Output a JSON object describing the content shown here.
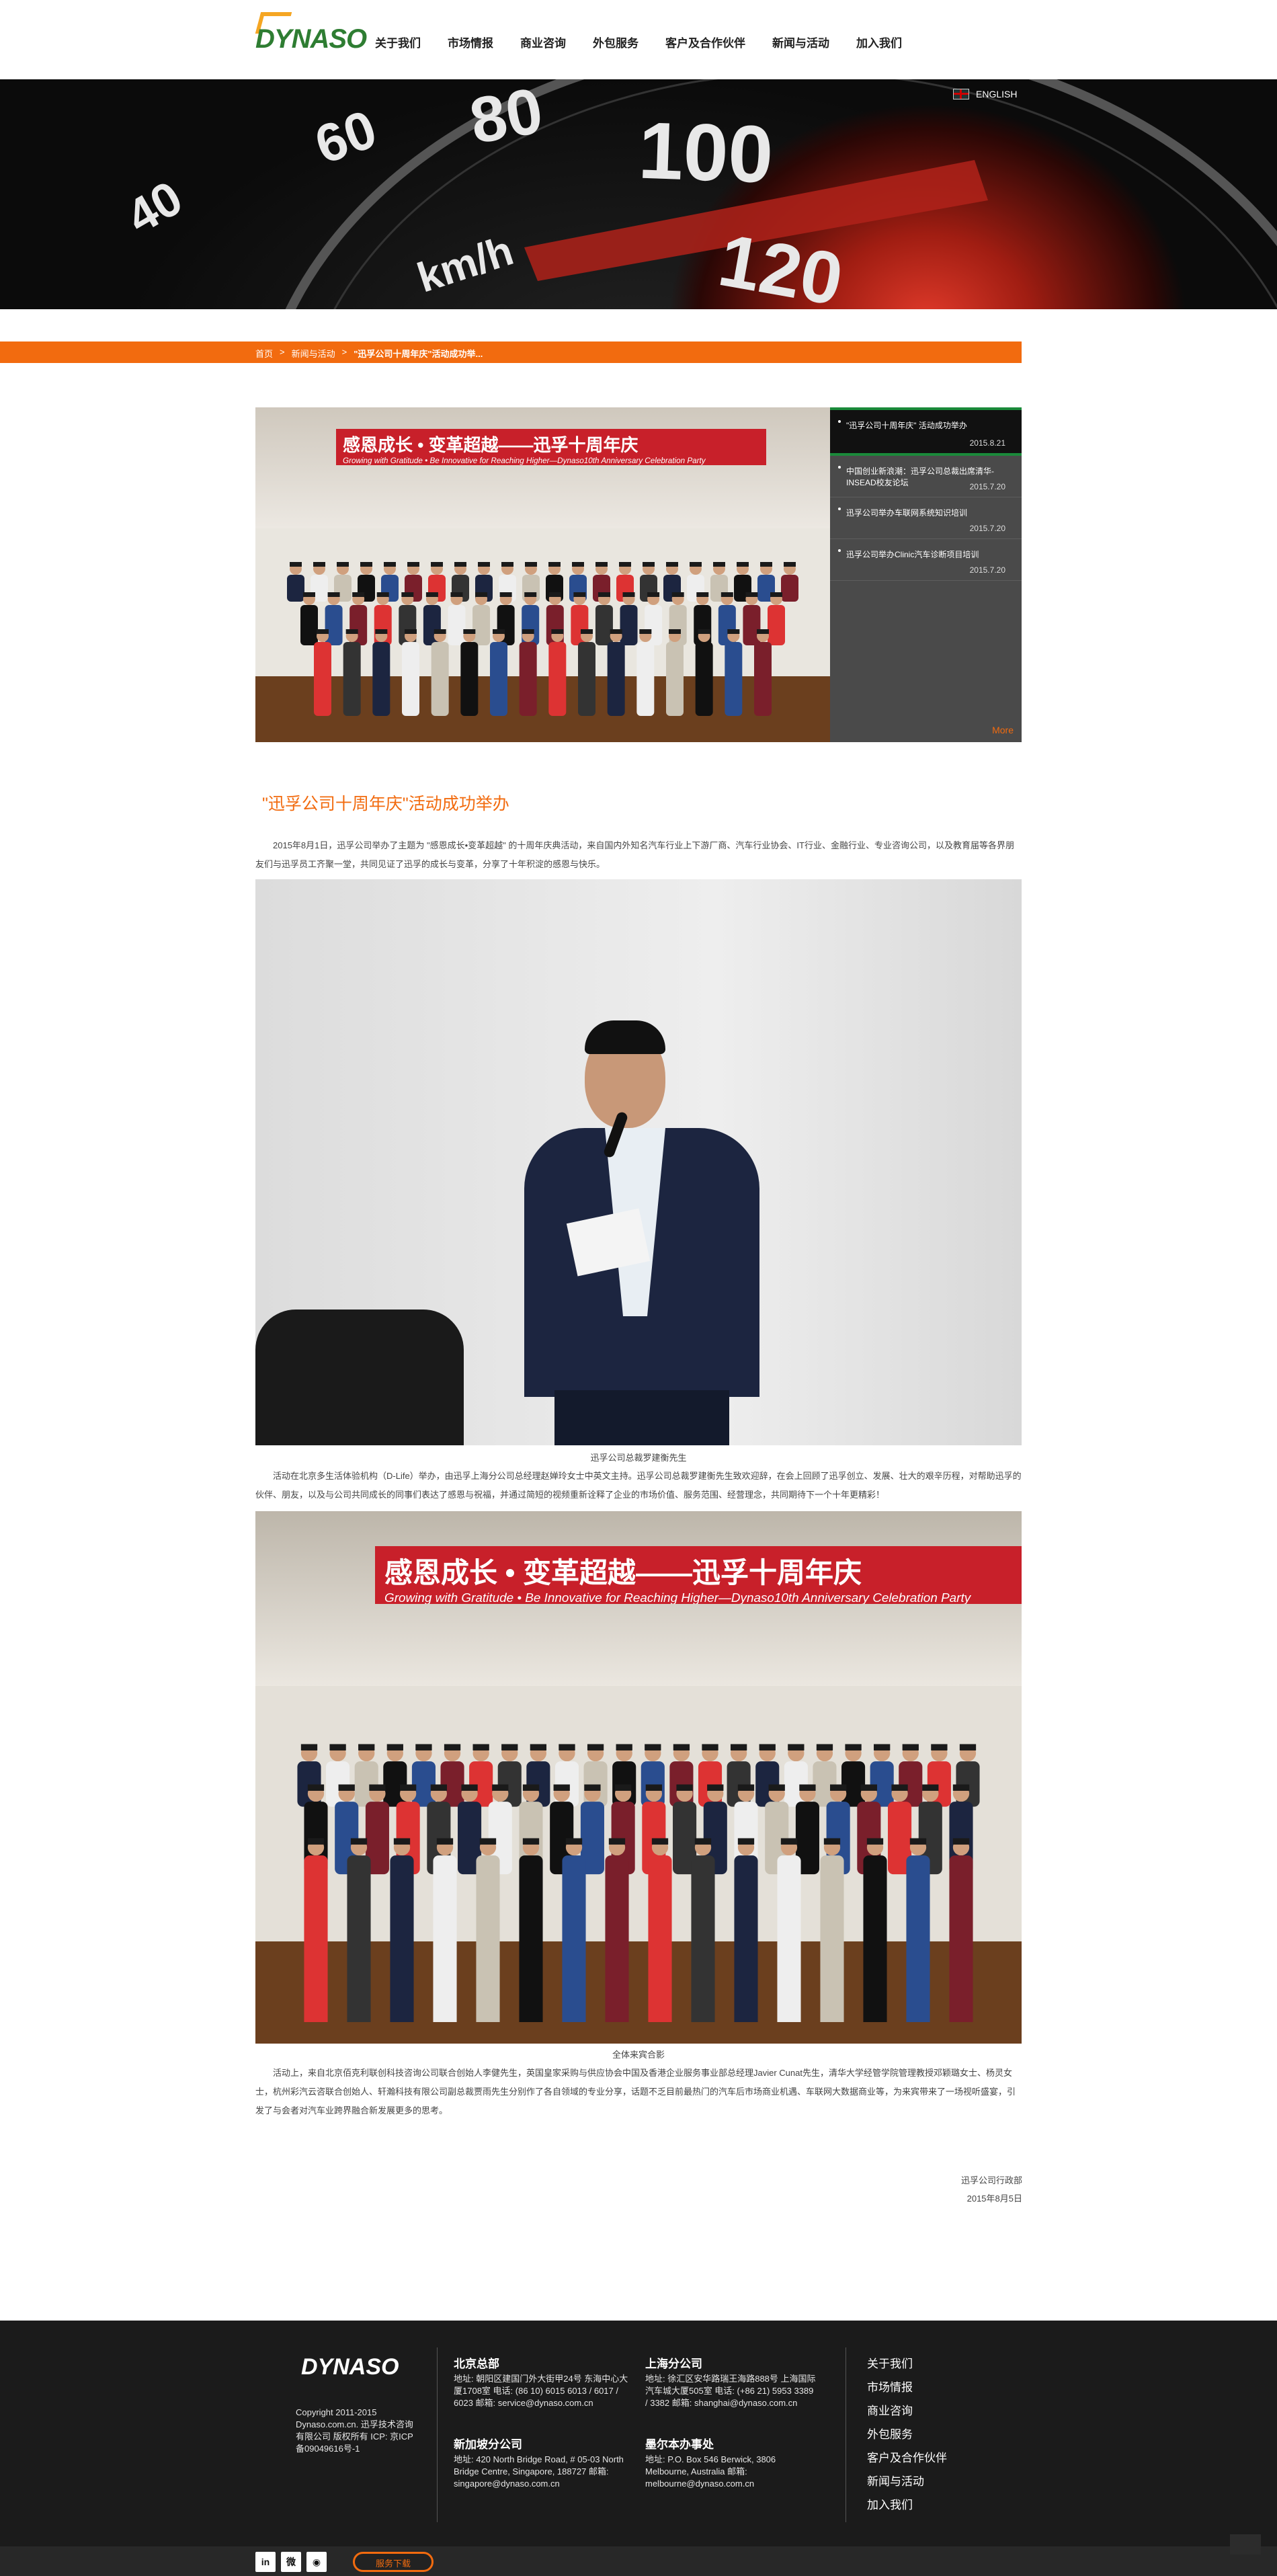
{
  "logo_text": "DYNASO",
  "nav": [
    "关于我们",
    "市场情报",
    "商业咨询",
    "外包服务",
    "客户及合作伙伴",
    "新闻与活动",
    "加入我们"
  ],
  "banner": {
    "dial_numbers": [
      "60",
      "80",
      "100",
      "40",
      "120"
    ],
    "unit": "km/h"
  },
  "language": "ENGLISH",
  "breadcrumb": {
    "home": "首页",
    "sep": ">",
    "section": "新闻与活动",
    "current": "\"迅孚公司十周年庆\"活动成功举..."
  },
  "gallery": {
    "items": [
      {
        "title": "\"迅孚公司十周年庆\" 活动成功举办",
        "date": "2015.8.21"
      },
      {
        "title": "中国创业新浪潮：迅孚公司总裁出席清华-INSEAD校友论坛",
        "date": "2015.7.20"
      },
      {
        "title": "迅孚公司举办车联网系统知识培训",
        "date": "2015.7.20"
      },
      {
        "title": "迅孚公司举办Clinic汽车诊断项目培训",
        "date": "2015.7.20"
      }
    ],
    "more": "More"
  },
  "article": {
    "title": "\"迅孚公司十周年庆\"活动成功举办",
    "para1": "2015年8月1日，迅孚公司举办了主题为 \"感恩成长•变革超越\" 的十周年庆典活动，来自国内外知名汽车行业上下游厂商、汽车行业协会、IT行业、金融行业、专业咨询公司，以及教育届等各界朋友们与迅孚员工齐聚一堂，共同见证了迅孚的成长与变革，分享了十年积淀的感恩与快乐。",
    "caption1": "迅孚公司总裁罗建衡先生",
    "para2": "活动在北京多生活体验机构（D-Life）举办，由迅孚上海分公司总经理赵婵玲女士中英文主持。迅孚公司总裁罗建衡先生致欢迎辞，在会上回顾了迅孚创立、发展、壮大的艰辛历程，对帮助迅孚的伙伴、朋友，以及与公司共同成长的同事们表达了感恩与祝福，并通过简短的视频重新诠释了企业的市场价值、服务范围、经营理念，共同期待下一个十年更精彩！",
    "caption2": "全体来宾合影",
    "para3": "活动上，来自北京佰克利联创科技咨询公司联合创始人李健先生，英国皇家采购与供应协会中国及香港企业服务事业部总经理Javier Cunat先生，清华大学经管学院管理教授邓颖璐女士、杨灵女士，杭州彩汽云咨联合创始人、轩瀚科技有限公司副总裁贾雨先生分别作了各自领域的专业分享，话题不乏目前最热门的汽车后市场商业机遇、车联网大数据商业等，为来宾带来了一场视听盛宴，引发了与会者对汽车业跨界融合新发展更多的思考。",
    "signature": "迅孚公司行政部",
    "sig_date": "2015年8月5日"
  },
  "photo": {
    "banner_cn": "感恩成长 • 变革超越——迅孚十周年庆",
    "banner_en": "Growing with Gratitude • Be Innovative for Reaching Higher—Dynaso10th Anniversary Celebration Party"
  },
  "footer": {
    "logo": "DYNASO",
    "copyright": "Copyright 2011-2015 Dynaso.com.cn. 迅孚技术咨询有限公司 版权所有 ICP: 京ICP备09049616号-1",
    "offices": [
      {
        "name": "北京总部",
        "addr": "地址: 朝阳区建国门外大街甲24号 东海中心大厦1708室 电话: (86 10) 6015 6013 / 6017 / 6023 邮箱: service@dynaso.com.cn"
      },
      {
        "name": "上海分公司",
        "addr": "地址: 徐汇区安华路瑞王海路888号 上海国际汽车城大厦505室 电话: (+86 21) 5953 3389 / 3382 邮箱: shanghai@dynaso.com.cn"
      },
      {
        "name": "新加坡分公司",
        "addr": "地址: 420 North Bridge Road, # 05-03 North Bridge Centre, Singapore, 188727 邮箱: singapore@dynaso.com.cn"
      },
      {
        "name": "墨尔本办事处",
        "addr": "地址: P.O. Box 546 Berwick, 3806 Melbourne, Australia 邮箱: melbourne@dynaso.com.cn"
      }
    ],
    "links": [
      "关于我们",
      "市场情报",
      "商业咨询",
      "外包服务",
      "客户及合作伙伴",
      "新闻与活动",
      "加入我们"
    ],
    "download": "服务下载",
    "social": [
      "in",
      "微",
      "◉"
    ]
  },
  "colors": {
    "accent": "#f26b0f",
    "footer_bg": "#1b1b1b",
    "gallery_bg": "#4a4a4a",
    "active_bar": "#1a8a3a"
  }
}
